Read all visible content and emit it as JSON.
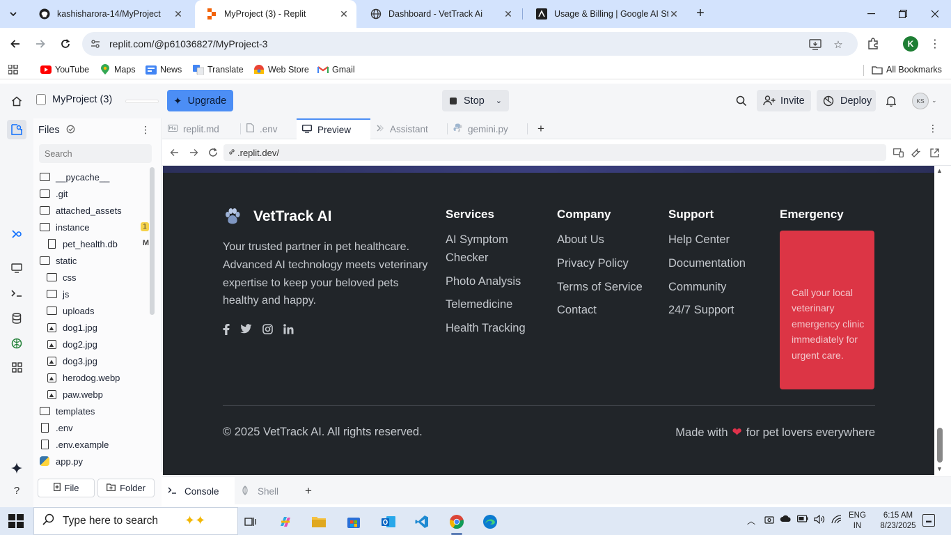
{
  "browser": {
    "tabs": [
      {
        "title": "kashisharora-14/MyProject",
        "icon": "github-icon"
      },
      {
        "title": "MyProject (3) - Replit",
        "icon": "replit-icon"
      },
      {
        "title": "Dashboard - VetTrack Ai",
        "icon": "globe-icon"
      },
      {
        "title": "Usage & Billing | Google AI Stud",
        "icon": "ai-studio-icon"
      }
    ],
    "url": "replit.com/@p61036827/MyProject-3",
    "profile_initial": "K",
    "bookmarks": [
      {
        "label": "YouTube",
        "icon": "youtube-icon"
      },
      {
        "label": "Maps",
        "icon": "maps-icon"
      },
      {
        "label": "News",
        "icon": "news-icon"
      },
      {
        "label": "Translate",
        "icon": "translate-icon"
      },
      {
        "label": "Web Store",
        "icon": "webstore-icon"
      },
      {
        "label": "Gmail",
        "icon": "gmail-icon"
      }
    ],
    "all_bookmarks": "All Bookmarks"
  },
  "replit": {
    "project_name": "MyProject (3)",
    "upgrade": "Upgrade",
    "stop": "Stop",
    "invite": "Invite",
    "deploy": "Deploy",
    "avatar": "KS",
    "files": {
      "title": "Files",
      "search_placeholder": "Search",
      "items": [
        {
          "name": "__pycache__",
          "type": "folder"
        },
        {
          "name": ".git",
          "type": "folder"
        },
        {
          "name": "attached_assets",
          "type": "folder"
        },
        {
          "name": "instance",
          "type": "folder",
          "badge": "1"
        },
        {
          "name": "pet_health.db",
          "type": "file",
          "badge": "M"
        },
        {
          "name": "static",
          "type": "folder"
        },
        {
          "name": "css",
          "type": "folder"
        },
        {
          "name": "js",
          "type": "folder"
        },
        {
          "name": "uploads",
          "type": "folder"
        },
        {
          "name": "dog1.jpg",
          "type": "image"
        },
        {
          "name": "dog2.jpg",
          "type": "image"
        },
        {
          "name": "dog3.jpg",
          "type": "image"
        },
        {
          "name": "herodog.webp",
          "type": "image"
        },
        {
          "name": "paw.webp",
          "type": "image"
        },
        {
          "name": "templates",
          "type": "folder"
        },
        {
          "name": ".env",
          "type": "file"
        },
        {
          "name": ".env.example",
          "type": "file"
        },
        {
          "name": "app.py",
          "type": "python"
        }
      ],
      "new_file": "File",
      "new_folder": "Folder"
    },
    "editor_tabs": [
      {
        "label": "replit.md",
        "icon": "markdown-icon"
      },
      {
        "label": ".env",
        "icon": "file-icon"
      },
      {
        "label": "Preview",
        "icon": "preview-icon"
      },
      {
        "label": "Assistant",
        "icon": "assistant-icon"
      },
      {
        "label": "gemini.py",
        "icon": "python-icon"
      }
    ],
    "preview_url": ".replit.dev/",
    "console_tabs": [
      {
        "label": "Console",
        "icon": "terminal-icon"
      },
      {
        "label": "Shell",
        "icon": "shell-icon"
      }
    ]
  },
  "site": {
    "brand": "VetTrack AI",
    "description": "Your trusted partner in pet healthcare. Advanced AI technology meets veterinary expertise to keep your beloved pets healthy and happy.",
    "social": [
      "facebook-icon",
      "twitter-icon",
      "instagram-icon",
      "linkedin-icon"
    ],
    "columns": [
      {
        "title": "Services",
        "links": [
          "AI Symptom Checker",
          "Photo Analysis",
          "Telemedicine",
          "Health Tracking"
        ]
      },
      {
        "title": "Company",
        "links": [
          "About Us",
          "Privacy Policy",
          "Terms of Service",
          "Contact"
        ]
      },
      {
        "title": "Support",
        "links": [
          "Help Center",
          "Documentation",
          "Community",
          "24/7 Support"
        ]
      }
    ],
    "emergency": {
      "title": "Emergency",
      "text": "Call your local veterinary emergency clinic immediately for urgent care."
    },
    "copyright": "© 2025 VetTrack AI. All rights reserved.",
    "made_with_prefix": "Made with",
    "made_with_suffix": "for pet lovers everywhere",
    "colors": {
      "footer_bg": "#212529",
      "emergency": "#dc3545",
      "heart": "#e0324b"
    }
  },
  "taskbar": {
    "search_placeholder": "Type here to search",
    "lang_line1": "ENG",
    "lang_line2": "IN",
    "time": "6:15 AM",
    "date": "8/23/2025"
  }
}
